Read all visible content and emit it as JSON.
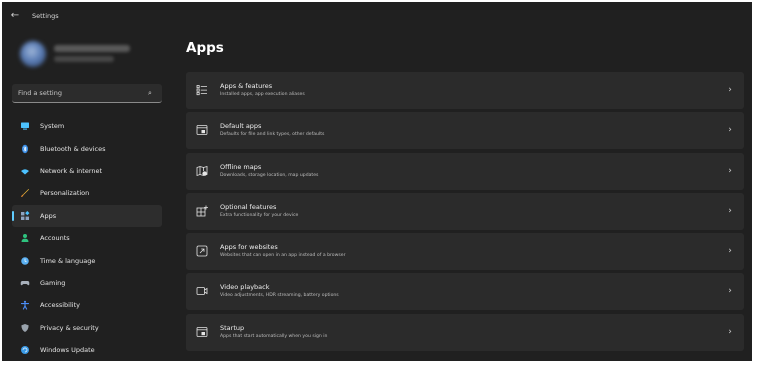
{
  "window": {
    "title": "Settings"
  },
  "search": {
    "placeholder": "Find a setting"
  },
  "sidebar": {
    "items": [
      {
        "label": "System",
        "icon": "system-icon",
        "color": "#4cc2ff"
      },
      {
        "label": "Bluetooth & devices",
        "icon": "bluetooth-icon",
        "color": "#3a8ee6"
      },
      {
        "label": "Network & internet",
        "icon": "network-icon",
        "color": "#4cc2ff"
      },
      {
        "label": "Personalization",
        "icon": "brush-icon",
        "color": "#f0b93a"
      },
      {
        "label": "Apps",
        "icon": "apps-icon",
        "color": "#8fa3bf",
        "selected": true
      },
      {
        "label": "Accounts",
        "icon": "person-icon",
        "color": "#2ec27e"
      },
      {
        "label": "Time & language",
        "icon": "globe-clock-icon",
        "color": "#5ab0f2"
      },
      {
        "label": "Gaming",
        "icon": "gamepad-icon",
        "color": "#a8b0bb"
      },
      {
        "label": "Accessibility",
        "icon": "accessibility-icon",
        "color": "#4c8df6"
      },
      {
        "label": "Privacy & security",
        "icon": "shield-icon",
        "color": "#9aa3ad"
      },
      {
        "label": "Windows Update",
        "icon": "update-icon",
        "color": "#3a9ae6"
      }
    ]
  },
  "main": {
    "title": "Apps",
    "cards": [
      {
        "title": "Apps & features",
        "description": "Installed apps, app execution aliases",
        "icon": "apps-features-icon"
      },
      {
        "title": "Default apps",
        "description": "Defaults for file and link types, other defaults",
        "icon": "default-apps-icon"
      },
      {
        "title": "Offline maps",
        "description": "Downloads, storage location, map updates",
        "icon": "offline-maps-icon"
      },
      {
        "title": "Optional features",
        "description": "Extra functionality for your device",
        "icon": "optional-features-icon"
      },
      {
        "title": "Apps for websites",
        "description": "Websites that can open in an app instead of a browser",
        "icon": "apps-for-websites-icon"
      },
      {
        "title": "Video playback",
        "description": "Video adjustments, HDR streaming, battery options",
        "icon": "video-playback-icon"
      },
      {
        "title": "Startup",
        "description": "Apps that start automatically when you sign in",
        "icon": "startup-icon"
      }
    ]
  }
}
